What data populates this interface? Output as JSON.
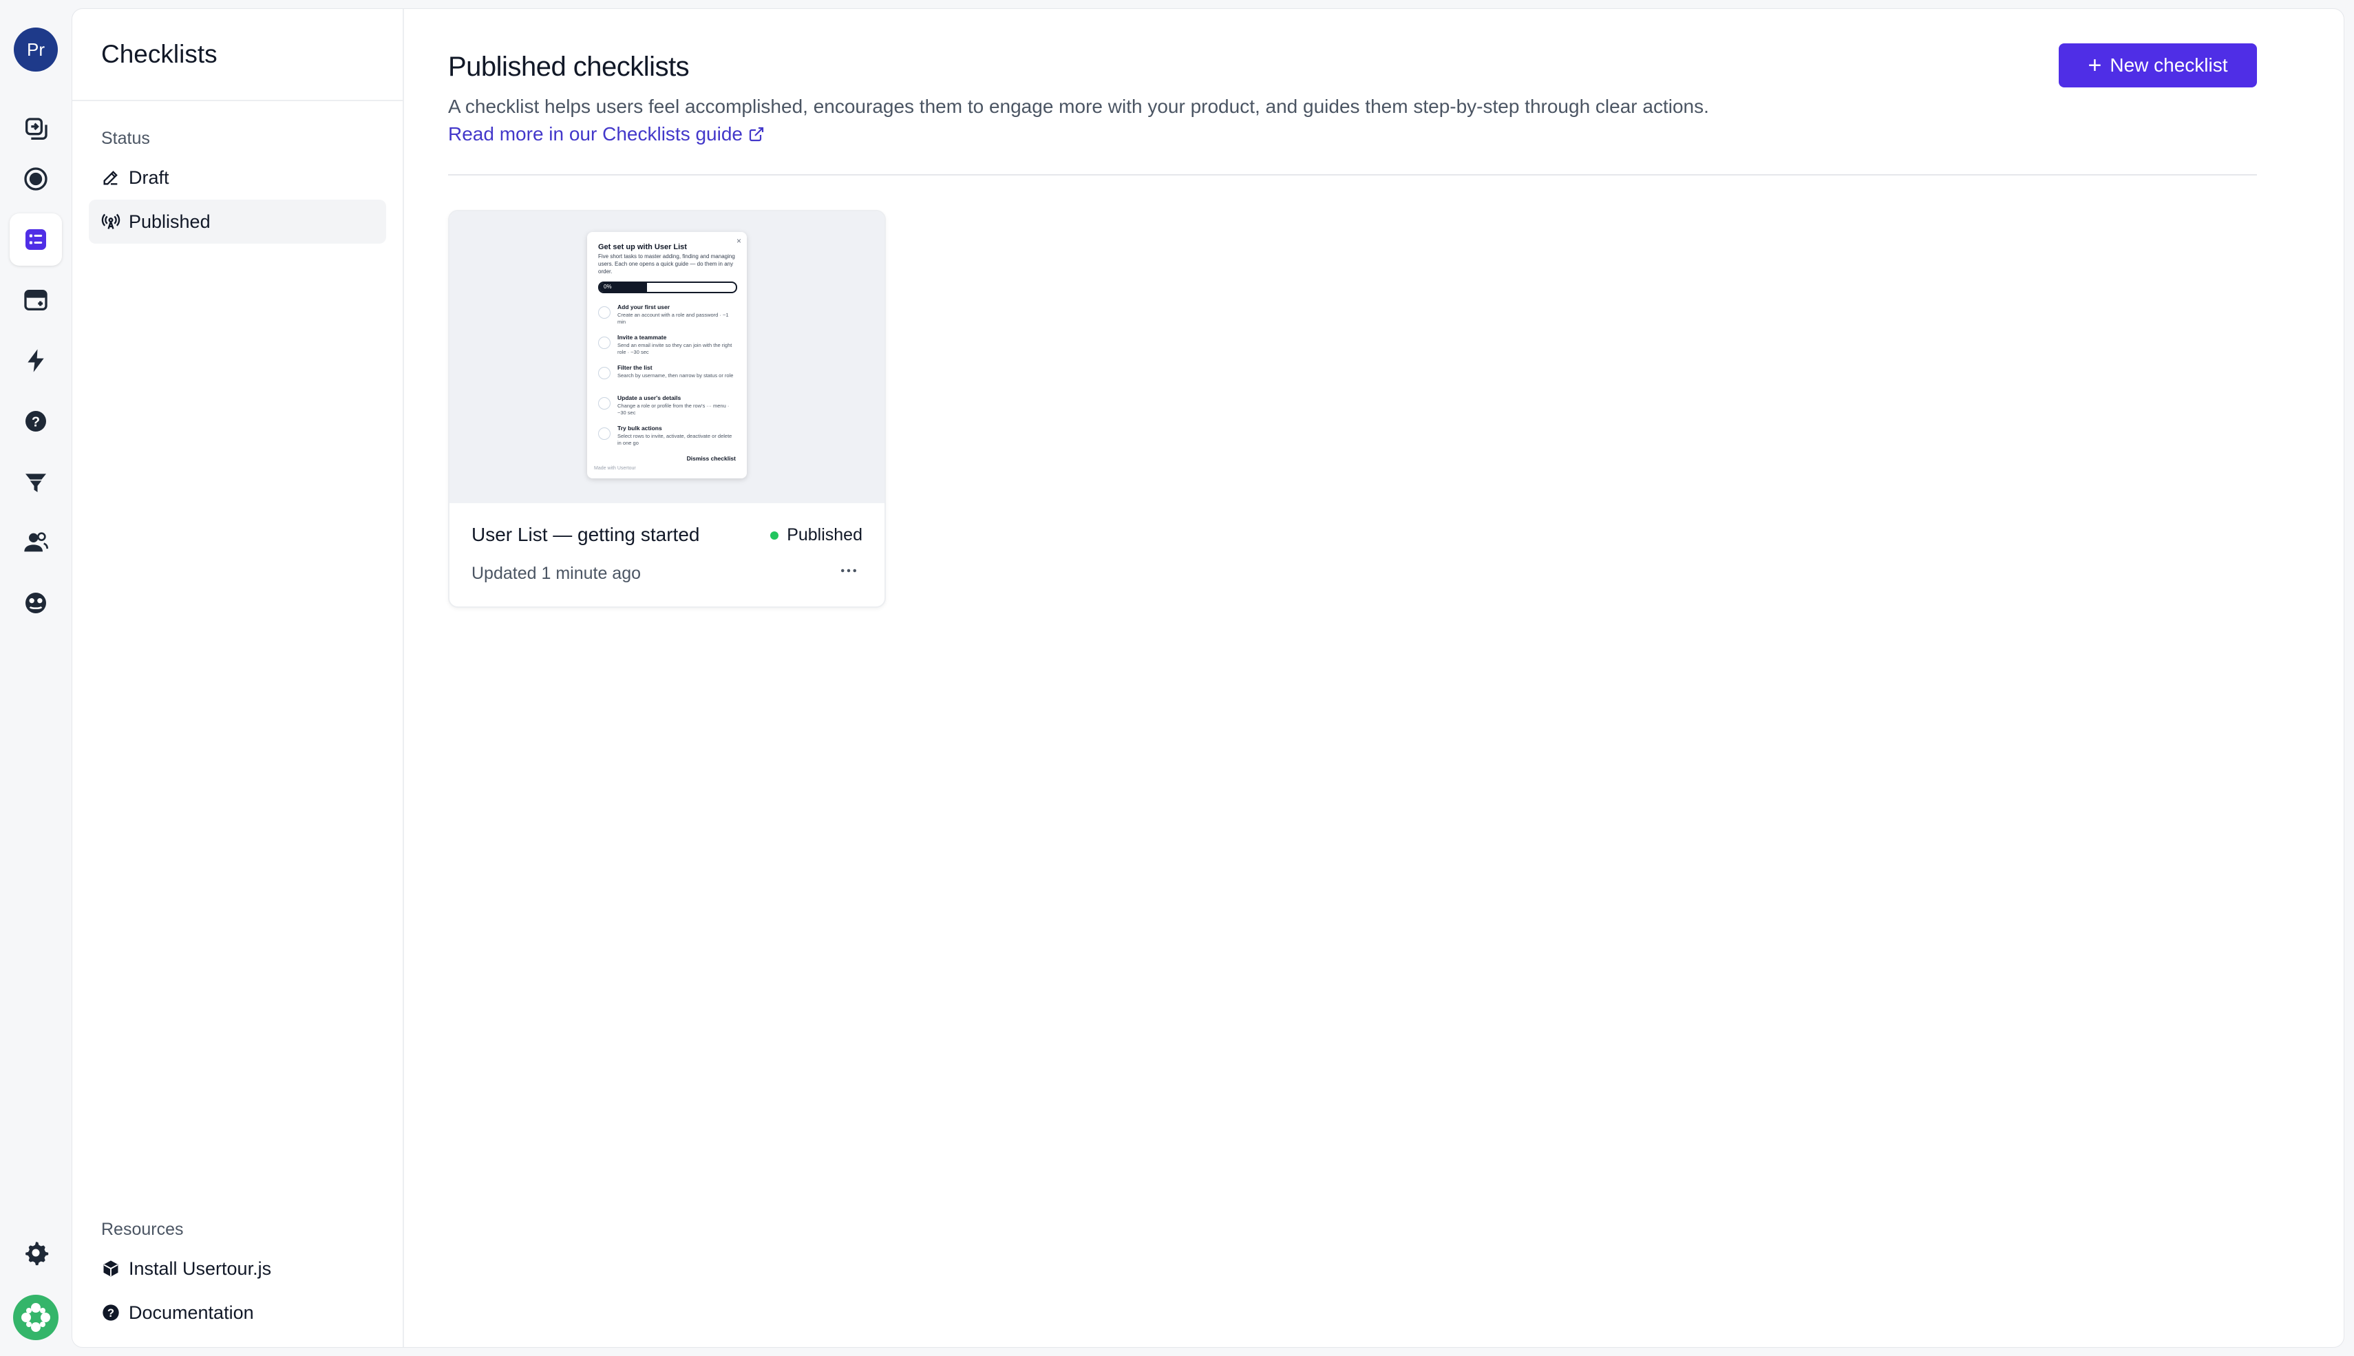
{
  "rail": {
    "avatar_initials": "Pr",
    "items": [
      {
        "icon": "flows-icon"
      },
      {
        "icon": "launchers-icon"
      },
      {
        "icon": "checklists-icon",
        "active": true
      },
      {
        "icon": "banners-icon"
      },
      {
        "icon": "events-icon"
      },
      {
        "icon": "help-icon"
      },
      {
        "icon": "segments-icon"
      },
      {
        "icon": "users-icon"
      },
      {
        "icon": "companies-icon"
      }
    ],
    "bottom": [
      {
        "icon": "gear-icon"
      },
      {
        "icon": "usertour-logo-icon"
      }
    ]
  },
  "sidebar": {
    "title": "Checklists",
    "status_label": "Status",
    "items": [
      {
        "label": "Draft",
        "icon": "pencil-icon"
      },
      {
        "label": "Published",
        "icon": "broadcast-icon",
        "active": true
      }
    ],
    "resources_label": "Resources",
    "resources": [
      {
        "label": "Install Usertour.js",
        "icon": "box-icon"
      },
      {
        "label": "Documentation",
        "icon": "question-circle-icon"
      }
    ]
  },
  "main": {
    "title": "Published checklists",
    "description": "A checklist helps users feel accomplished, encourages them to engage more with your product, and guides them step-by-step through clear actions.",
    "guide_link": "Read more in our Checklists guide",
    "new_button": "New checklist"
  },
  "card": {
    "name": "User List — getting started",
    "status": "Published",
    "updated": "Updated 1 minute ago",
    "preview": {
      "title": "Get set up with User List",
      "subtitle": "Five short tasks to master adding, finding and managing users. Each one opens a quick guide — do them in any order.",
      "progress_label": "0%",
      "progress": 0.35,
      "tasks": [
        {
          "title": "Add your first user",
          "desc": "Create an account with a role and password · ~1 min"
        },
        {
          "title": "Invite a teammate",
          "desc": "Send an email invite so they can join with the right role · ~30 sec"
        },
        {
          "title": "Filter the list",
          "desc": "Search by username, then narrow by status or role"
        },
        {
          "title": "Update a user's details",
          "desc": "Change a role or profile from the row's ··· menu · ~30 sec"
        },
        {
          "title": "Try bulk actions",
          "desc": "Select rows to invite, activate, deactivate or delete in one go"
        }
      ],
      "dismiss": "Dismiss checklist",
      "footer": "Made with Usertour"
    }
  },
  "colors": {
    "accent": "#4f2ee6",
    "link": "#4338ca",
    "published_dot": "#22c55e",
    "avatar": "#1e3a8a"
  }
}
